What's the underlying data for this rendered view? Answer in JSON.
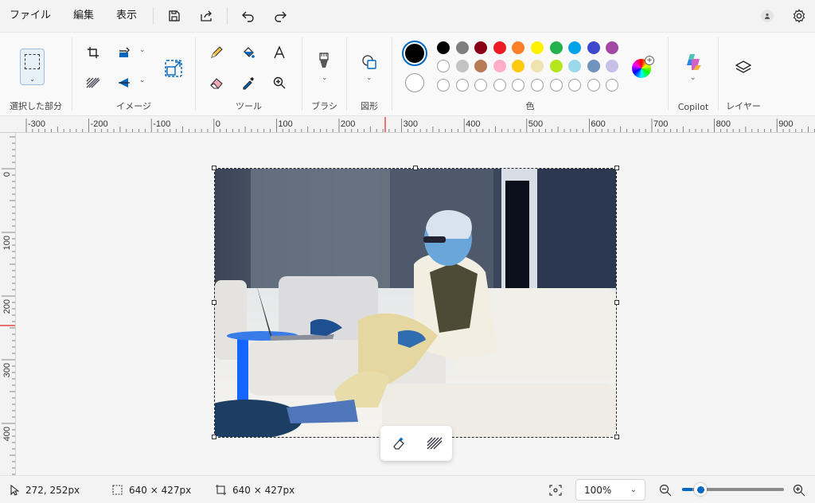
{
  "menu": {
    "file": "ファイル",
    "edit": "編集",
    "view": "表示"
  },
  "icons": {
    "save": "save-icon",
    "share": "share-icon",
    "undo": "undo-icon",
    "redo": "redo-icon",
    "account": "account-icon",
    "settings": "gear-icon"
  },
  "ribbon": {
    "selection_label": "選択した部分",
    "image_label": "イメージ",
    "tools_label": "ツール",
    "brush_label": "ブラシ",
    "shapes_label": "図形",
    "colors_label": "色",
    "copilot_label": "Copilot",
    "layers_label": "レイヤー"
  },
  "colors": {
    "primary": "#000000",
    "secondary": "#ffffff",
    "row1": [
      "#000000",
      "#7f7f7f",
      "#880015",
      "#ed1c24",
      "#ff7f27",
      "#fff200",
      "#22b14c",
      "#00a2e8",
      "#3f48cc",
      "#a349a4"
    ],
    "row2": [
      "#ffffff",
      "#c3c3c3",
      "#b97a57",
      "#ffaec9",
      "#ffc90e",
      "#efe4b0",
      "#b5e61d",
      "#99d9ea",
      "#7092be",
      "#c8bfe7"
    ],
    "accent": "#0067c0"
  },
  "ruler": {
    "top_labels": [
      "-300",
      "-200",
      "-100",
      "0",
      "100",
      "200",
      "300",
      "400",
      "500",
      "600",
      "700",
      "800",
      "900"
    ],
    "left_labels": [
      "0",
      "100",
      "200",
      "300",
      "400"
    ]
  },
  "status": {
    "cursor": "272, 252px",
    "selection_size": "640 × 427px",
    "canvas_size": "640 × 427px",
    "zoom": "100%"
  },
  "zoom_level": 0.1
}
